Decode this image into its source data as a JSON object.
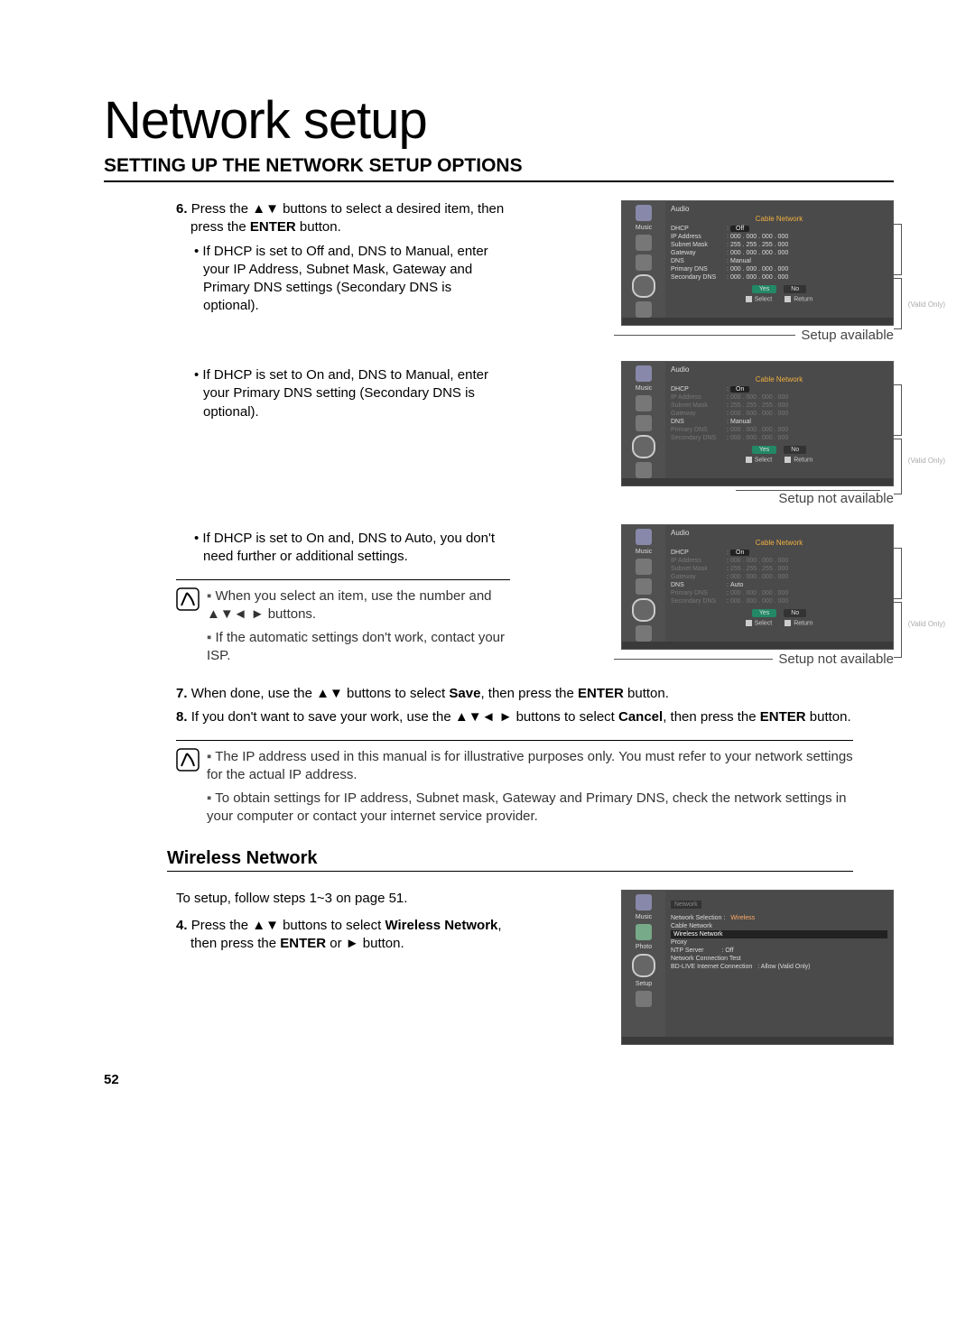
{
  "page": {
    "title": "Network setup",
    "section_heading": "SETTING UP THE NETWORK SETUP OPTIONS",
    "page_number": "52"
  },
  "step6": {
    "num": "6.",
    "text_a": "Press the ▲▼ buttons to select a desired item, then press the ",
    "enter": "ENTER",
    "text_b": " button.",
    "bullet": "If DHCP is set to Off and, DNS to Manual, enter your IP Address, Subnet Mask, Gateway and Primary DNS settings (Secondary DNS is optional).",
    "caption": "Setup available"
  },
  "screenshot1": {
    "tab_audio": "Audio",
    "title": "Cable Network",
    "rows": {
      "dhcp": {
        "label": "DHCP",
        "value": "Off",
        "pill": true
      },
      "ip": {
        "label": "IP Address",
        "value": "000 . 000 . 000 . 000"
      },
      "subnet": {
        "label": "Subnet Mask",
        "value": "255 . 255 . 255 . 000"
      },
      "gateway": {
        "label": "Gateway",
        "value": "000 . 000 . 000 . 000"
      },
      "dns": {
        "label": "DNS",
        "value": "Manual"
      },
      "pdns": {
        "label": "Primary DNS",
        "value": "000 . 000 . 000 . 000"
      },
      "sdns": {
        "label": "Secondary DNS",
        "value": "000 . 000 . 000 . 000"
      }
    },
    "yes": "Yes",
    "no": "No",
    "select": "Select",
    "return": "Return",
    "callout_bot": "(Valid Only)",
    "side_music": "Music"
  },
  "block2": {
    "bullet": "If DHCP is set to On and, DNS to Manual, enter your Primary DNS setting (Secondary DNS is optional).",
    "caption": "Setup not available"
  },
  "screenshot2": {
    "tab_audio": "Audio",
    "title": "Cable Network",
    "rows": {
      "dhcp": {
        "label": "DHCP",
        "value": "On",
        "pill": true
      },
      "ip": {
        "label": "IP Address",
        "value": "000 . 000 . 000 . 000"
      },
      "subnet": {
        "label": "Subnet Mask",
        "value": "255 . 255 . 255 . 000"
      },
      "gateway": {
        "label": "Gateway",
        "value": "000 . 000 . 000 . 000"
      },
      "dns": {
        "label": "DNS",
        "value": "Manual"
      },
      "pdns": {
        "label": "Primary DNS",
        "value": "000 . 000 . 000 . 000"
      },
      "sdns": {
        "label": "Secondary DNS",
        "value": "000 . 000 . 000 . 000"
      }
    },
    "yes": "Yes",
    "no": "No",
    "select": "Select",
    "return": "Return",
    "callout": "(Valid Only)",
    "side_music": "Music"
  },
  "block3": {
    "bullet": "If DHCP is set to On and, DNS to Auto, you don't need further or additional settings.",
    "caption": "Setup not available"
  },
  "screenshot3": {
    "tab_audio": "Audio",
    "title": "Cable Network",
    "rows": {
      "dhcp": {
        "label": "DHCP",
        "value": "On",
        "pill": true
      },
      "ip": {
        "label": "IP Address",
        "value": "000 . 000 . 000 . 000"
      },
      "subnet": {
        "label": "Subnet Mask",
        "value": "255 . 255 . 255 . 000"
      },
      "gateway": {
        "label": "Gateway",
        "value": "000 . 000 . 000 . 000"
      },
      "dns": {
        "label": "DNS",
        "value": "Auto"
      },
      "pdns": {
        "label": "Primary DNS",
        "value": "000 . 000 . 000 . 000"
      },
      "sdns": {
        "label": "Secondary DNS",
        "value": "000 . 000 . 000 . 000"
      }
    },
    "yes": "Yes",
    "no": "No",
    "select": "Select",
    "return": "Return",
    "callout": "(Valid Only)",
    "side_music": "Music"
  },
  "note1": {
    "a": "When you select an item, use the number and ▲▼◄ ► buttons.",
    "b": "If the automatic settings don't work, contact your ISP."
  },
  "step7": {
    "num": "7.",
    "a": "When done, use the ▲▼ buttons to select ",
    "save": "Save",
    "b": ", then press the ",
    "enter": "ENTER",
    "c": " button."
  },
  "step8": {
    "num": "8.",
    "a": "If you don't want to save your work, use the ▲▼◄ ► buttons to select ",
    "cancel": "Cancel",
    "b": ", then press the ",
    "enter": "ENTER",
    "c": " button."
  },
  "note2": {
    "a": "The IP address used in this manual is for illustrative purposes only. You must refer to your network settings for the actual IP address.",
    "b": "To obtain settings for IP address, Subnet mask, Gateway and Primary DNS, check the network settings in your computer or contact your internet service provider."
  },
  "wireless": {
    "heading": "Wireless Network",
    "intro": "To setup, follow steps 1~3 on page 51.",
    "step4_num": "4.",
    "step4_a": "Press the ▲▼ buttons to select ",
    "step4_bold": "Wireless Network",
    "step4_b": ", then press the ",
    "step4_enter": "ENTER",
    "step4_c": " or ► button."
  },
  "screenshot4": {
    "side_music": "Music",
    "side_photo": "Photo",
    "side_setup": "Setup",
    "menu": {
      "netsel_label": "Network Selection :",
      "netsel_val": "Wireless",
      "cable": "Cable Network",
      "wireless": "Wireless Network",
      "proxy": "Proxy",
      "ntp_label": "NTP Server",
      "ntp_val": ": Off",
      "nct": "Network Connection Test",
      "bdlive_label": "BD-LIVE Internet Connection",
      "bdlive_val": ": Allow (Valid Only)"
    },
    "tab_network": "Network"
  }
}
